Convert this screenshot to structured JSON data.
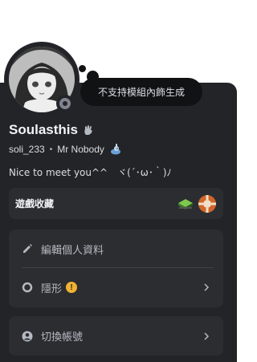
{
  "tooltip": {
    "text": "不支持模組內飾生成"
  },
  "user": {
    "display_name": "Soulasthis",
    "username": "soli_233",
    "separator": "•",
    "nickname": "Mr Nobody",
    "bio": "Nice to meet you^^　ヾ(´･ω･｀)ﾉ",
    "status": "invisible"
  },
  "games": {
    "label": "遊戲收藏",
    "icons": [
      "game-icon-green",
      "game-icon-orange"
    ]
  },
  "actions": {
    "edit_profile": "編輯個人資料",
    "invisible": "隱形",
    "switch_account": "切換帳號"
  },
  "colors": {
    "card": "#232428",
    "panel": "#2b2d31",
    "tooltip": "#111214",
    "warning": "#f0b232",
    "status_offline": "#80848e"
  }
}
